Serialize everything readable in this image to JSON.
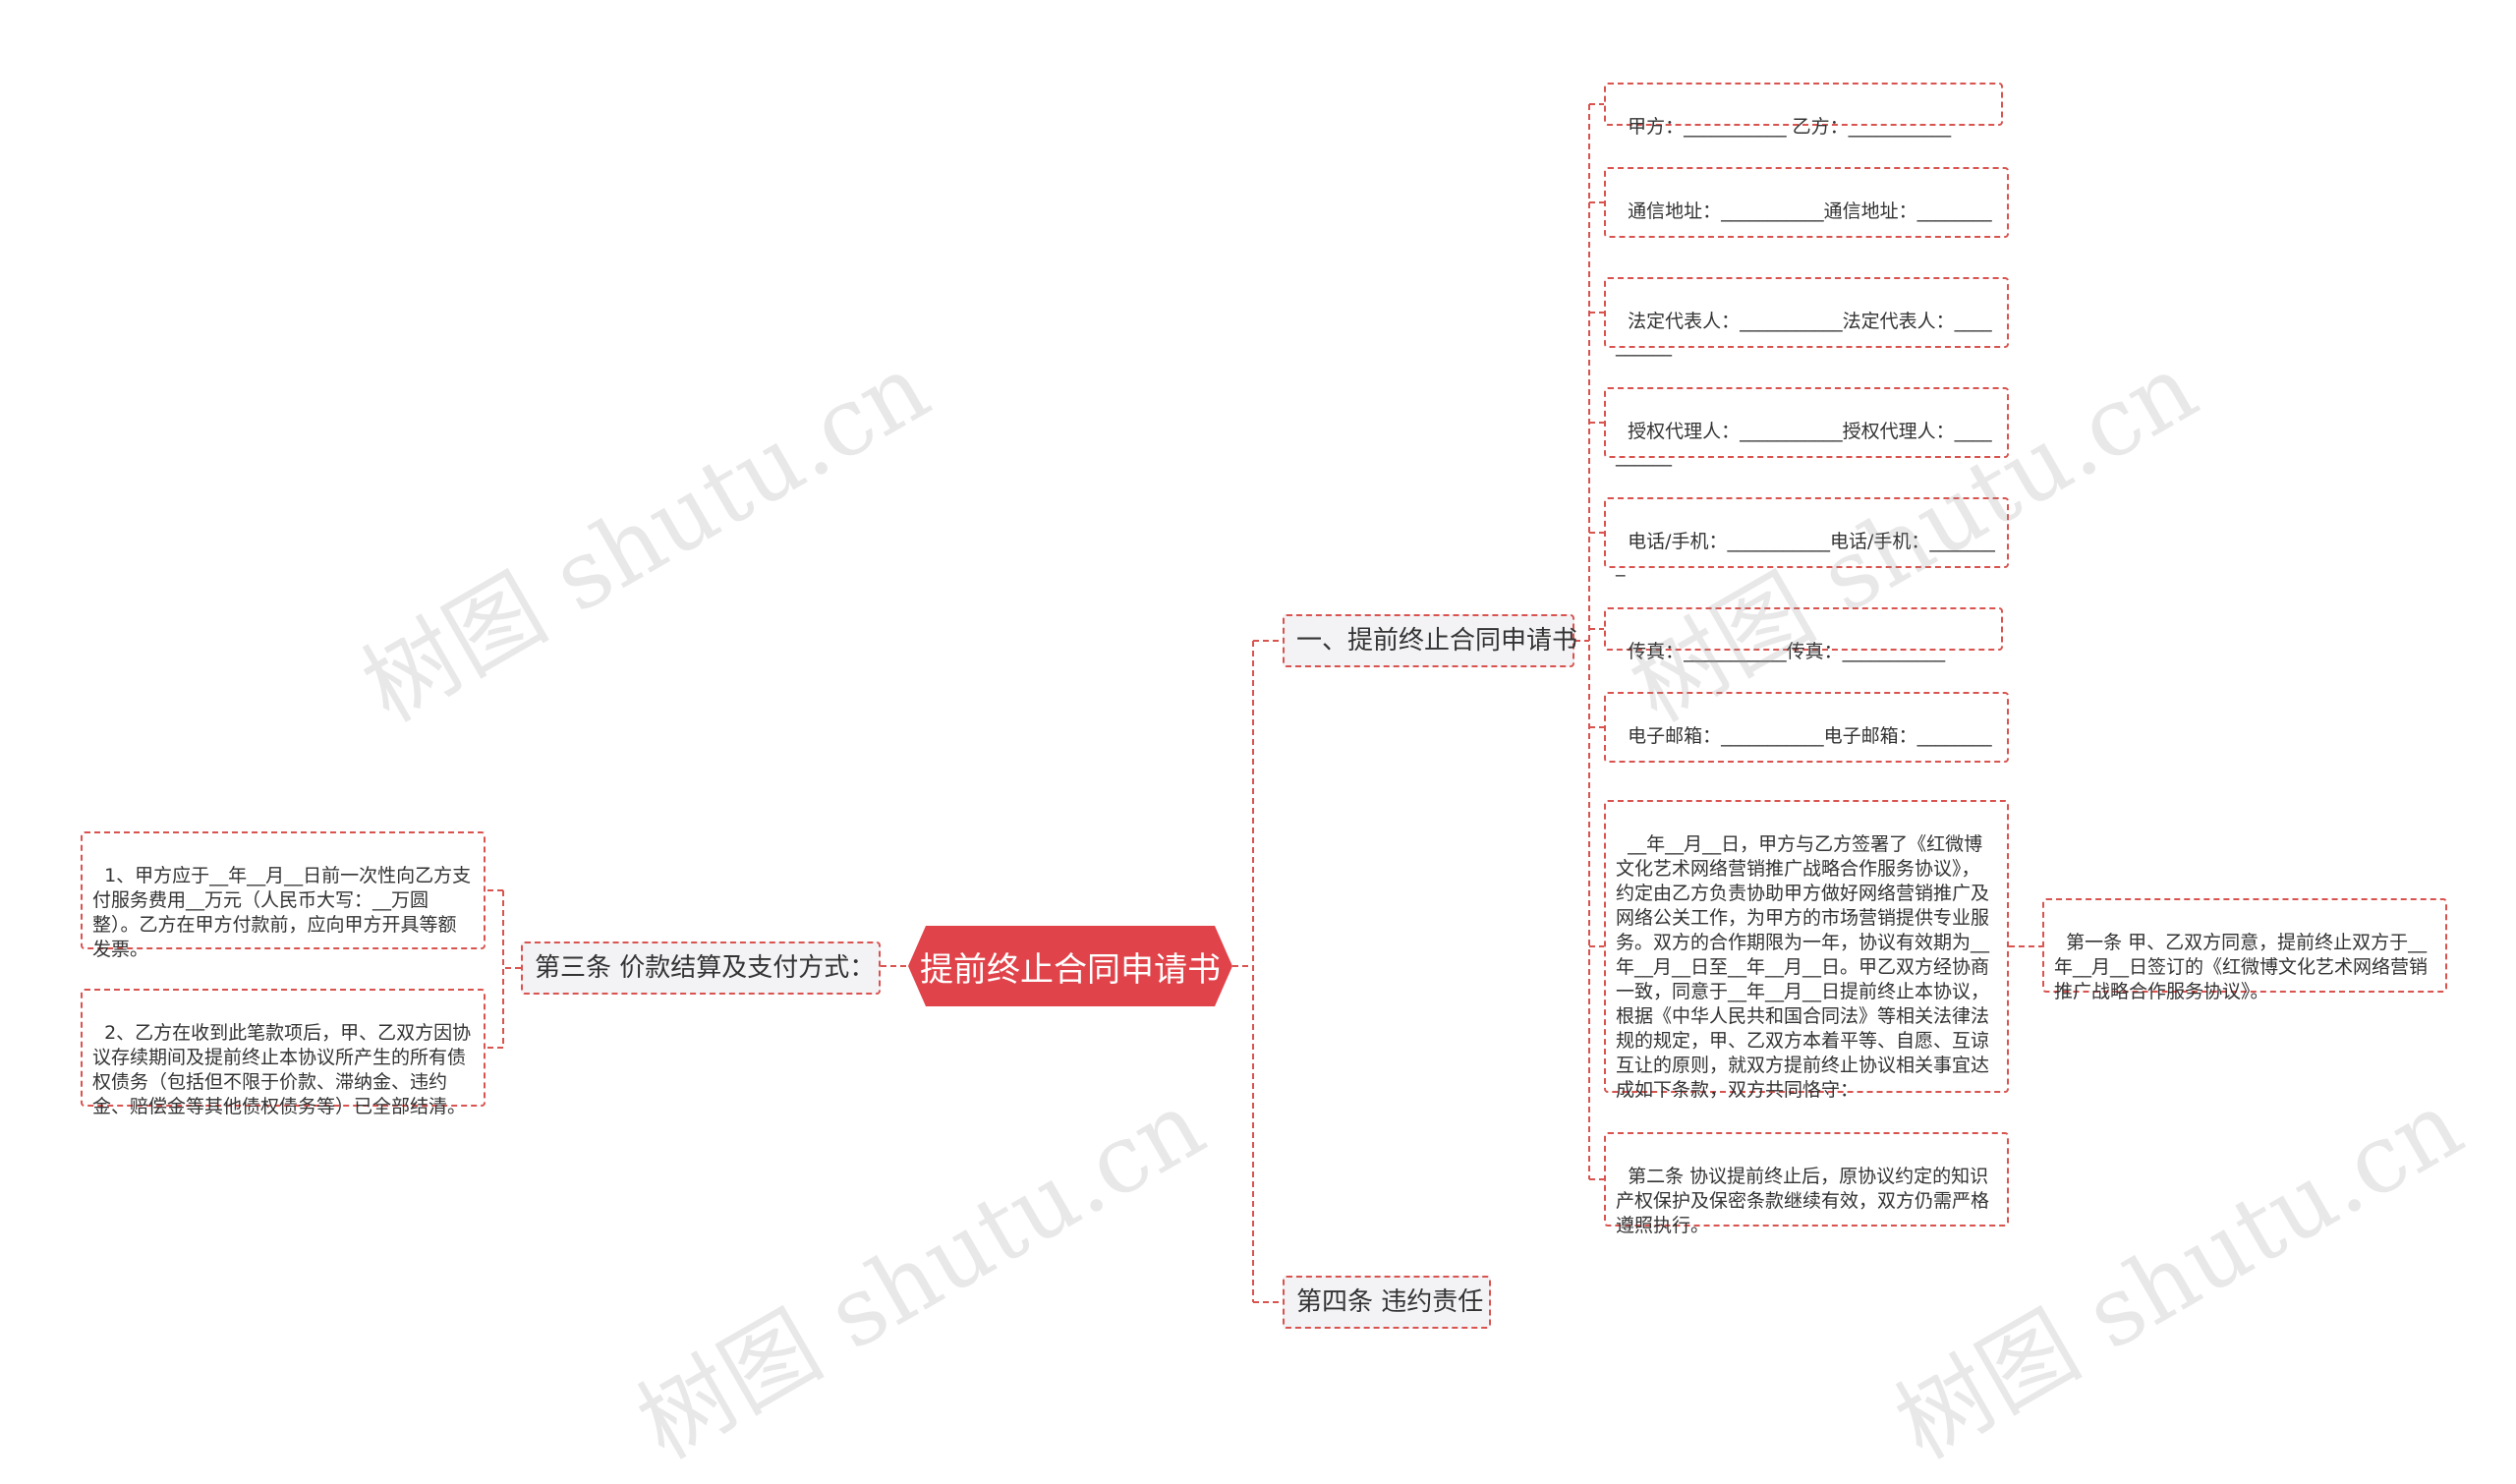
{
  "root": {
    "label": "提前终止合同申请书"
  },
  "branches": {
    "b1": {
      "label": "一、提前终止合同申请书"
    },
    "b3": {
      "label": "第三条 价款结算及支付方式："
    },
    "b4": {
      "label": "第四条 违约责任"
    }
  },
  "leaves": {
    "l1": "甲方：___________ 乙方：___________",
    "l2": "通信地址：___________通信地址：________",
    "l3": "法定代表人：___________法定代表人：__________",
    "l4": "授权代理人：___________授权代理人：__________",
    "l5": "电话/手机：___________电话/手机：________",
    "l6": "传真：___________传真：___________",
    "l7": "电子邮箱：___________电子邮箱：________",
    "l8": "__年__月__日，甲方与乙方签署了《红微博文化艺术网络营销推广战略合作服务协议》，约定由乙方负责协助甲方做好网络营销推广及网络公关工作，为甲方的市场营销提供专业服务。双方的合作期限为一年，协议有效期为__年__月__日至__年__月__日。甲乙双方经协商一致，同意于__年__月__日提前终止本协议，根据《中华人民共和国合同法》等相关法律法规的规定，甲、乙双方本着平等、自愿、互谅互让的原则，就双方提前终止协议相关事宜达成如下条款，双方共同恪守：",
    "l9": "第二条 协议提前终止后，原协议约定的知识产权保护及保密条款继续有效，双方仍需严格遵照执行。",
    "l10": "第一条 甲、乙双方同意，提前终止双方于__年__月__日签订的《红微博文化艺术网络营销推广战略合作服务协议》。",
    "l11": "1、甲方应于__年__月__日前一次性向乙方支付服务费用__万元（人民币大写：__万圆整）。乙方在甲方付款前，应向甲方开具等额发票。",
    "l12": "2、乙方在收到此笔款项后，甲、乙双方因协议存续期间及提前终止本协议所产生的所有债权债务（包括但不限于价款、滞纳金、违约金、赔偿金等其他债权债务等）已全部结清。"
  },
  "watermark": "树图 shutu.cn",
  "colors": {
    "accent": "#e0434a",
    "line": "#d9534f",
    "branch_bg": "#f3f3f6"
  }
}
